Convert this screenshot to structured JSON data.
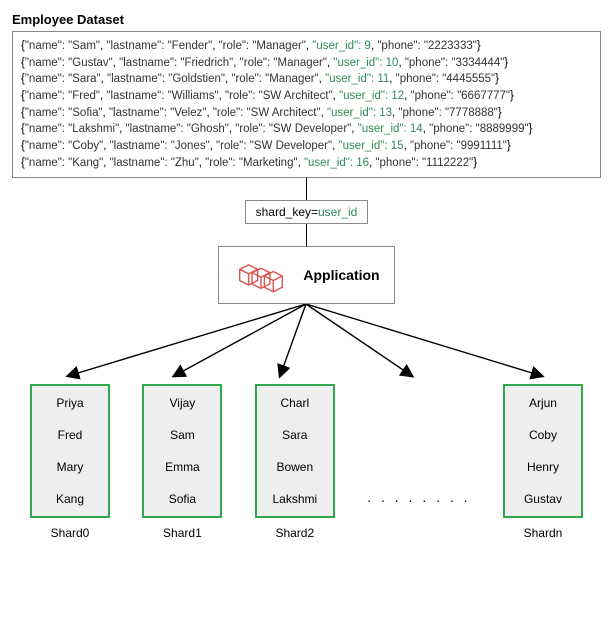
{
  "title": "Employee Dataset",
  "records": [
    {
      "name": "Sam",
      "lastname": "Fender",
      "role": "Manager",
      "user_id": 9,
      "phone": "2223333"
    },
    {
      "name": "Gustav",
      "lastname": "Friedrich",
      "role": "Manager",
      "user_id": 10,
      "phone": "3334444"
    },
    {
      "name": "Sara",
      "lastname": "Goldstien",
      "role": "Manager",
      "user_id": 11,
      "phone": "4445555"
    },
    {
      "name": "Fred",
      "lastname": "Williams",
      "role": "SW Architect",
      "user_id": 12,
      "phone": "6667777"
    },
    {
      "name": "Sofia",
      "lastname": "Velez",
      "role": "SW Architect",
      "user_id": 13,
      "phone": "7778888"
    },
    {
      "name": "Lakshmi",
      "lastname": "Ghosh",
      "role": "SW Developer",
      "user_id": 14,
      "phone": "8889999"
    },
    {
      "name": "Coby",
      "lastname": "Jones",
      "role": "SW Developer",
      "user_id": 15,
      "phone": "9991111"
    },
    {
      "name": "Kang",
      "lastname": "Zhu",
      "role": "Marketing",
      "user_id": 16,
      "phone": "1112222"
    }
  ],
  "shard_key": {
    "prefix": "shard_key=",
    "value": "user_id"
  },
  "application_label": "Application",
  "ellipsis": ". . . . . . . .",
  "shards": [
    {
      "label": "Shard0",
      "items": [
        "Priya",
        "Fred",
        "Mary",
        "Kang"
      ]
    },
    {
      "label": "Shard1",
      "items": [
        "Vijay",
        "Sam",
        "Emma",
        "Sofia"
      ]
    },
    {
      "label": "Shard2",
      "items": [
        "Charl",
        "Sara",
        "Bowen",
        "Lakshmi"
      ]
    },
    {
      "label": "Shardn",
      "items": [
        "Arjun",
        "Coby",
        "Henry",
        "Gustav"
      ]
    }
  ]
}
